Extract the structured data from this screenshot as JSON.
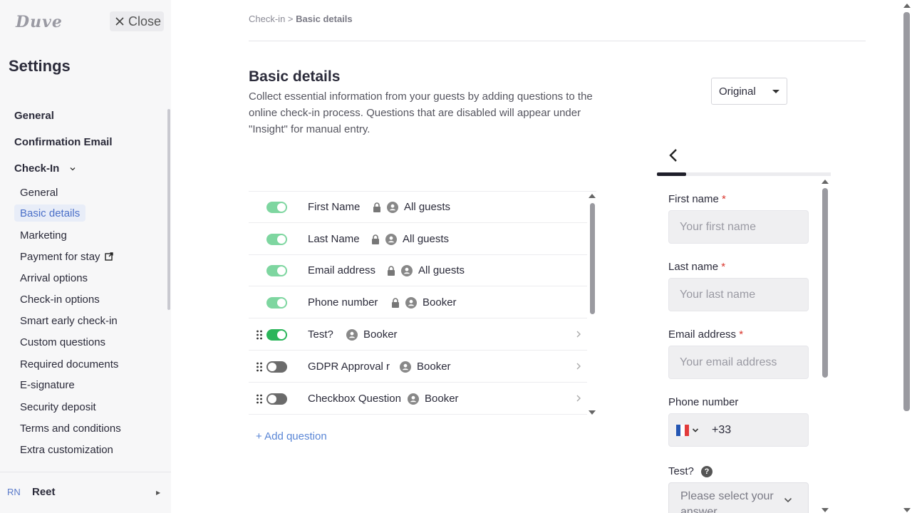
{
  "sidebar": {
    "logo": "Duve",
    "close_label": "Close",
    "title": "Settings",
    "top_items": [
      "General",
      "Confirmation Email",
      "Check-In"
    ],
    "checkin_items": [
      "General",
      "Basic details",
      "Marketing",
      "Payment for stay",
      "Arrival options",
      "Check-in options",
      "Smart early check-in",
      "Custom questions",
      "Required documents",
      "E-signature",
      "Security deposit",
      "Terms and conditions",
      "Extra customization"
    ],
    "active_item": "Basic details",
    "user": {
      "initials": "RN",
      "name": "Reet"
    }
  },
  "breadcrumb": {
    "parent": "Check-in",
    "separator": ">",
    "current": "Basic details"
  },
  "page": {
    "title": "Basic details",
    "description": "Collect essential information from your guests by adding questions to the online check-in process. Questions that are disabled will appear under \"Insight\" for manual entry."
  },
  "language_select": {
    "value": "Original"
  },
  "questions": [
    {
      "label": "First Name",
      "locked": true,
      "audience": "All guests",
      "enabled": true,
      "draggable": false
    },
    {
      "label": "Last Name",
      "locked": true,
      "audience": "All guests",
      "enabled": true,
      "draggable": false
    },
    {
      "label": "Email address",
      "locked": true,
      "audience": "All guests",
      "enabled": true,
      "draggable": false
    },
    {
      "label": "Phone number",
      "locked": true,
      "audience": "Booker",
      "enabled": true,
      "draggable": false
    },
    {
      "label": "Test?",
      "locked": false,
      "audience": "Booker",
      "enabled": true,
      "draggable": true
    },
    {
      "label": "GDPR Approval r",
      "locked": false,
      "audience": "Booker",
      "enabled": false,
      "draggable": true
    },
    {
      "label": "Checkbox Question",
      "locked": false,
      "audience": "Booker",
      "enabled": false,
      "draggable": true
    }
  ],
  "add_question_label": "+ Add question",
  "preview": {
    "fields": [
      {
        "label": "First name",
        "required": true,
        "placeholder": "Your first name"
      },
      {
        "label": "Last name",
        "required": true,
        "placeholder": "Your last name"
      },
      {
        "label": "Email address",
        "required": true,
        "placeholder": "Your email address"
      },
      {
        "label": "Phone number",
        "required": false,
        "country_code": "+33"
      }
    ],
    "test_question": {
      "label": "Test?",
      "placeholder": "Please select your answer"
    },
    "required_marker": "*"
  },
  "colors": {
    "accent": "#4a6fc8",
    "toggle_on": "#2bb55a",
    "toggle_on_light": "#7ed6a0",
    "toggle_off": "#6b6b6b",
    "required": "#d9342b",
    "link": "#5a86d6"
  },
  "icons": {
    "close": "close-icon",
    "external_link": "external-link-icon",
    "lock": "lock-icon",
    "person": "person-icon",
    "grip": "drag-grip-icon",
    "back": "chevron-left-icon",
    "help": "help-icon"
  }
}
